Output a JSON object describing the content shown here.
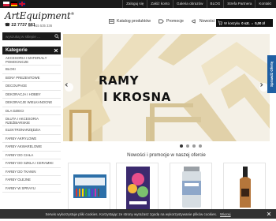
{
  "topbar": {
    "languages": [
      "pl",
      "de",
      "en"
    ],
    "links": [
      "Zaloguj się",
      "Załóż konto",
      "Galeria obrazów",
      "BLOG",
      "Strefa Partnera",
      "Kontakt"
    ]
  },
  "header": {
    "logo": "ArtEquipment",
    "phone": "22 7737 861",
    "phone_alt": "tel. 515 535 336",
    "menu": [
      "Katalog produktów",
      "Promocje",
      "Nowości"
    ],
    "cart_label": "W koszyku",
    "cart_count": "0 szt.",
    "cart_sep": "=",
    "cart_total": "0,00 zł"
  },
  "search": {
    "placeholder": "wyszukaj w sklepie ..."
  },
  "sidebar": {
    "title": "Kategorie",
    "items": [
      "AKCESORIA I MATERIAŁY POMOCNICZE",
      "BLOKI",
      "BONY PREZENTOWE",
      "DECOUPAGE",
      "DEKORACJA I HOBBY",
      "DEKORACJE WIELKANOCNE",
      "DLA DZIECI",
      "DŁUTA I AKCESORIA RZEŹBIARSKIE",
      "ELEKTRONARZĘDZIA",
      "FARBY AKRYLOWE",
      "FARBY AKWARELOWE",
      "FARBY DO CIAŁA",
      "FARBY DO SZKŁA I CERAMIKI",
      "FARBY DO TKANIN",
      "FARBY OLEJNE",
      "FARBY W SPRAYU"
    ]
  },
  "banner": {
    "line1": "RAMY",
    "line2": "I KROSNA",
    "slides": 4,
    "active_slide": 1
  },
  "ebook_tab": "Sprawdź Ofertę",
  "news": {
    "title": "Nowości i promocje w naszej ofercie"
  },
  "cookie": {
    "text": "Serwis wykorzystuje pliki cookies. Korzystając ze strony wyrażasz zgodę na wykorzystywanie plików cookies.",
    "more": "Więcej"
  },
  "colors": {
    "dark": "#1b1b1b",
    "accent_blue": "#1f5fa3",
    "wood": "#e8d9b3"
  }
}
